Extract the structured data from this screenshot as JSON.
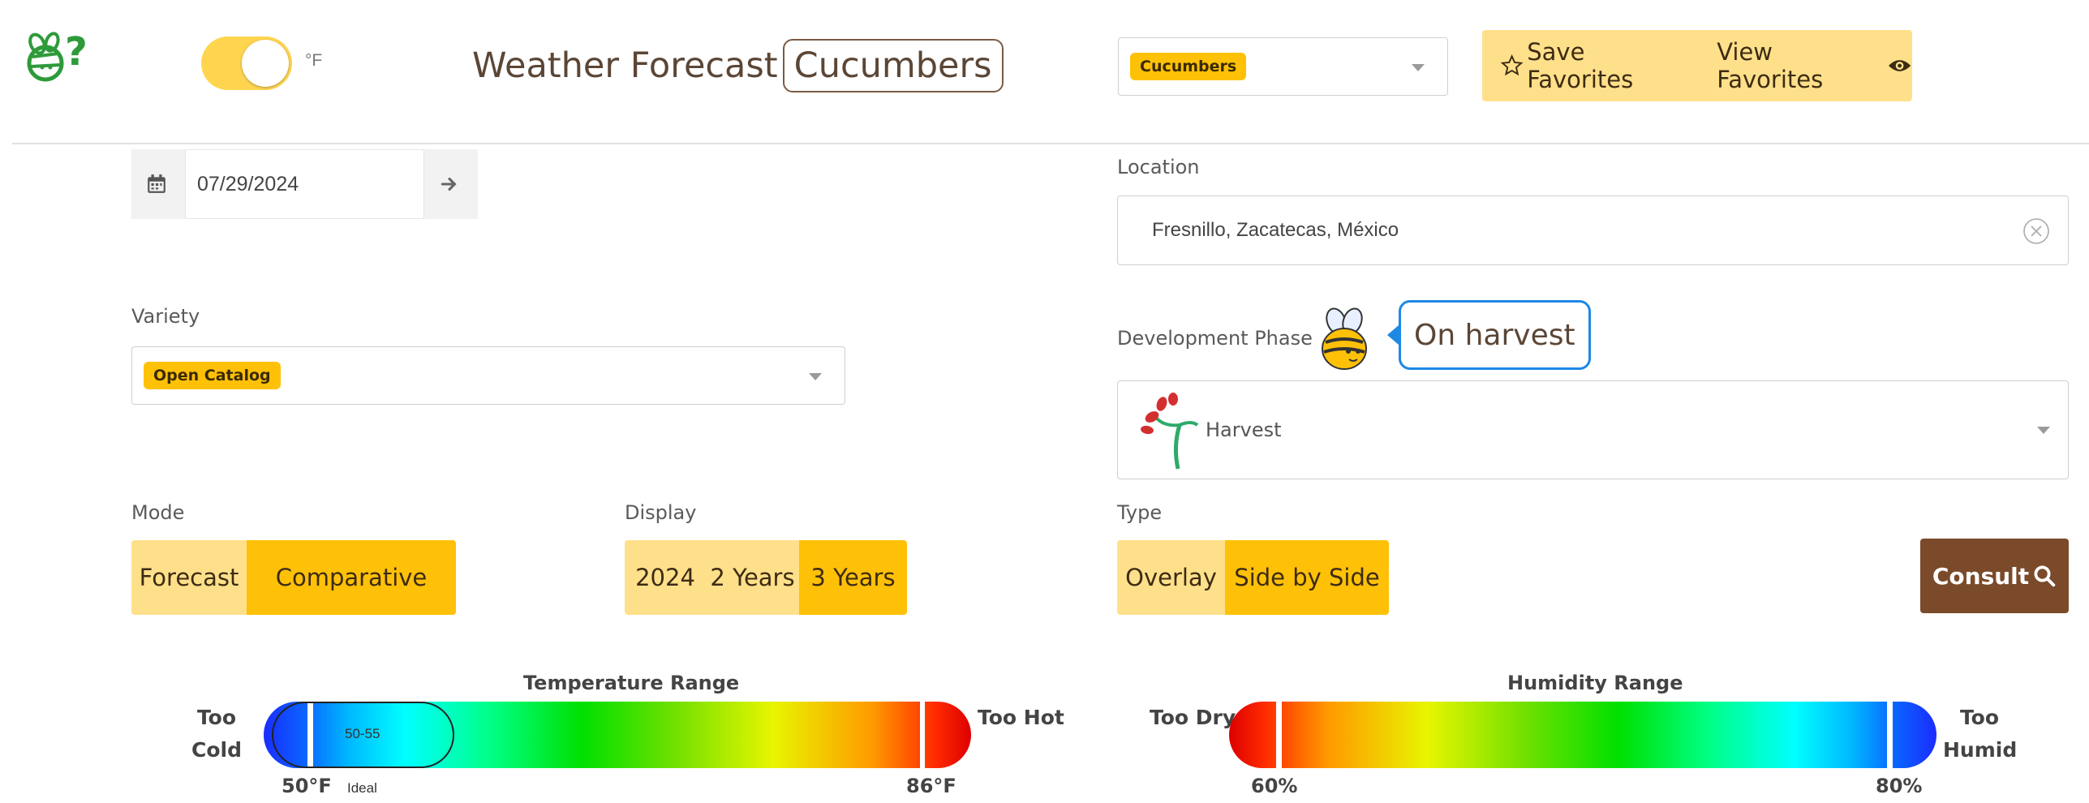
{
  "header": {
    "unit_label": "°F",
    "title": "Weather Forecast",
    "crop_badge": "Cucumbers",
    "crop_select_value": "Cucumbers",
    "save_favorites": "Save Favorites",
    "view_favorites": "View Favorites"
  },
  "date": {
    "value": "07/29/2024"
  },
  "location": {
    "label": "Location",
    "value": "Fresnillo, Zacatecas, México"
  },
  "variety": {
    "label": "Variety",
    "value": "Open Catalog"
  },
  "phase": {
    "label": "Development Phase",
    "bubble": "On harvest",
    "value": "Harvest"
  },
  "mode": {
    "label": "Mode",
    "options": [
      "Forecast",
      "Comparative"
    ],
    "selected": "Comparative"
  },
  "display": {
    "label": "Display",
    "options": [
      "2024",
      "2 Years",
      "3 Years"
    ],
    "selected": "3 Years"
  },
  "type": {
    "label": "Type",
    "options": [
      "Overlay",
      "Side by Side"
    ],
    "selected": "Side by Side"
  },
  "consult": {
    "label": "Consult"
  },
  "temperature_range": {
    "title": "Temperature Range",
    "too_low_line1": "Too",
    "too_low_line2": "Cold",
    "too_high": "Too Hot",
    "min_label": "50°F",
    "max_label": "86°F",
    "ideal_value": "50-55",
    "ideal_label": "Ideal"
  },
  "humidity_range": {
    "title": "Humidity Range",
    "too_low": "Too Dry",
    "too_high_line1": "Too",
    "too_high_line2": "Humid",
    "min_label": "60%",
    "max_label": "80%"
  },
  "colors": {
    "accent": "#ffc107",
    "accent_light": "#ffe08a",
    "consult_bg": "#7a4a2a",
    "logo_green": "#2e9a3a",
    "bubble_border": "#1e88e5"
  }
}
